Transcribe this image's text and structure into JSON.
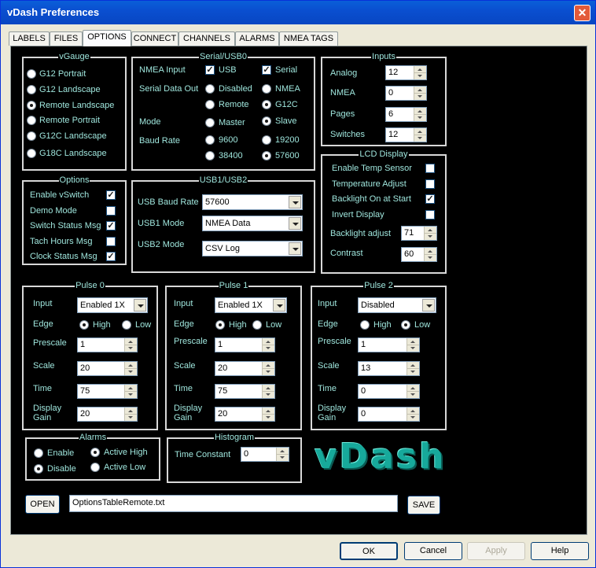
{
  "window": {
    "title": "vDash Preferences"
  },
  "tabs": [
    "LABELS",
    "FILES",
    "OPTIONS",
    "CONNECT",
    "CHANNELS",
    "ALARMS",
    "NMEA TAGS"
  ],
  "vgauge": {
    "title": "vGauge",
    "options": [
      "G12 Portrait",
      "G12 Landscape",
      "Remote Landscape",
      "Remote Portrait",
      "G12C Landscape",
      "G18C Landscape"
    ],
    "selected": "Remote Landscape"
  },
  "serial": {
    "title": "Serial/USB0",
    "nmea_input": "NMEA Input",
    "usb": "USB",
    "serial": "Serial",
    "serial_data_out": "Serial Data Out",
    "disabled": "Disabled",
    "nmea": "NMEA",
    "remote": "Remote",
    "g12c": "G12C",
    "mode": "Mode",
    "master": "Master",
    "slave": "Slave",
    "baud_rate": "Baud Rate",
    "b9600": "9600",
    "b19200": "19200",
    "b38400": "38400",
    "b57600": "57600"
  },
  "inputs": {
    "title": "Inputs",
    "analog": "Analog",
    "analog_val": "12",
    "nmea": "NMEA",
    "nmea_val": "0",
    "pages": "Pages",
    "pages_val": "6",
    "switches": "Switches",
    "switches_val": "12"
  },
  "options": {
    "title": "Options",
    "enable_vswitch": "Enable vSwitch",
    "demo_mode": "Demo Mode",
    "switch_status": "Switch Status Msg",
    "tach_hours": "Tach Hours Msg",
    "clock_status": "Clock Status Msg"
  },
  "usb12": {
    "title": "USB1/USB2",
    "usb_baud": "USB Baud Rate",
    "usb_baud_val": "57600",
    "usb1_mode": "USB1 Mode",
    "usb1_val": "NMEA Data",
    "usb2_mode": "USB2 Mode",
    "usb2_val": "CSV Log"
  },
  "lcd": {
    "title": "LCD Display",
    "enable_temp": "Enable Temp Sensor",
    "temp_adjust": "Temperature Adjust",
    "backlight_start": "Backlight On at Start",
    "invert": "Invert Display",
    "backlight_adjust": "Backlight adjust",
    "backlight_val": "71",
    "contrast": "Contrast",
    "contrast_val": "60"
  },
  "pulse_labels": {
    "input": "Input",
    "edge": "Edge",
    "high": "High",
    "low": "Low",
    "prescale": "Prescale",
    "scale": "Scale",
    "time": "Time",
    "display": "Display",
    "gain": "Gain"
  },
  "pulse0": {
    "title": "Pulse 0",
    "input": "Enabled 1X",
    "prescale": "1",
    "scale": "20",
    "time": "75",
    "gain": "20"
  },
  "pulse1": {
    "title": "Pulse 1",
    "input": "Enabled 1X",
    "prescale": "1",
    "scale": "20",
    "time": "75",
    "gain": "20"
  },
  "pulse2": {
    "title": "Pulse 2",
    "input": "Disabled",
    "prescale": "1",
    "scale": "13",
    "time": "0",
    "gain": "0"
  },
  "alarms": {
    "title": "Alarms",
    "enable": "Enable",
    "active_high": "Active High",
    "disable": "Disable",
    "active_low": "Active Low"
  },
  "histogram": {
    "title": "Histogram",
    "time_constant": "Time Constant",
    "value": "0"
  },
  "logo": "vDash",
  "file": {
    "open": "OPEN",
    "filename": "OptionsTableRemote.txt",
    "save": "SAVE"
  },
  "footer": {
    "ok": "OK",
    "cancel": "Cancel",
    "apply": "Apply",
    "help": "Help"
  }
}
